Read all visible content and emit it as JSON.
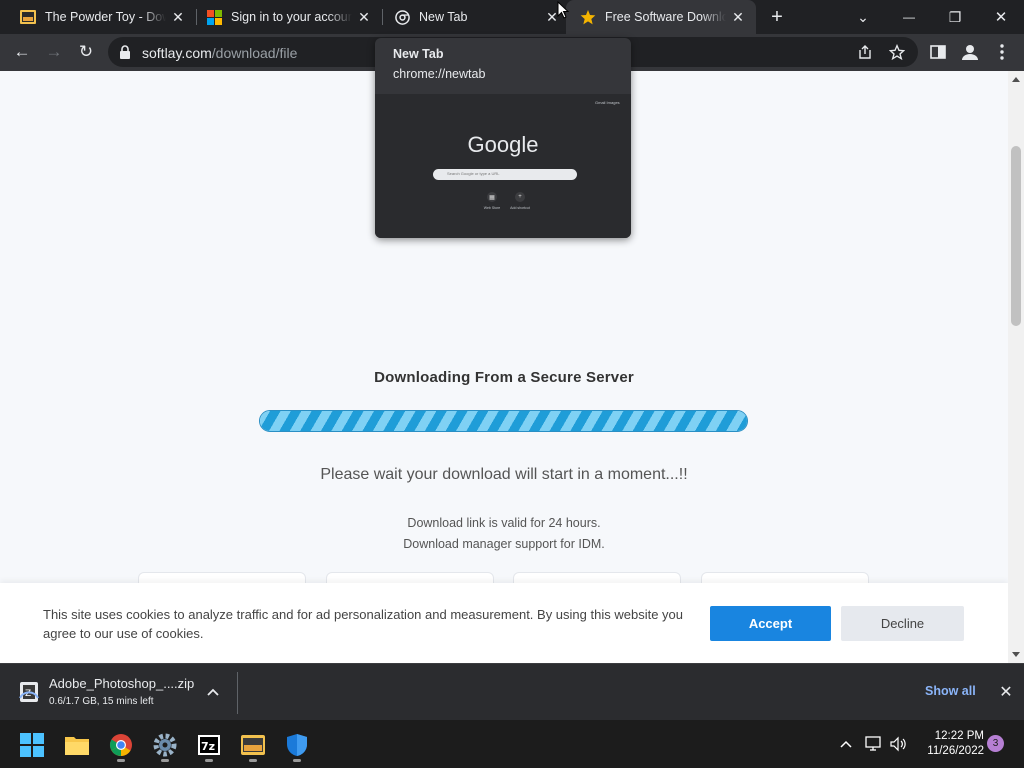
{
  "tabs": [
    {
      "title": "The Powder Toy - Download",
      "icon": "powder-toy-icon",
      "active": false
    },
    {
      "title": "Sign in to your account",
      "icon": "microsoft-icon",
      "active": false
    },
    {
      "title": "New Tab",
      "icon": "chrome-icon",
      "active": false
    },
    {
      "title": "Free Software Downloads",
      "icon": "star-icon",
      "active": true
    }
  ],
  "new_tab_symbol": "+",
  "window_controls": {
    "dropdown": "⌄",
    "minimize": "—",
    "restore": "❐",
    "close": "✕"
  },
  "toolbar": {
    "back": "←",
    "forward": "→",
    "reload": "↻"
  },
  "url": {
    "host": "softlay.com",
    "path": "/download/file"
  },
  "hover_card": {
    "title": "New Tab",
    "url": "chrome://newtab",
    "preview": {
      "logo": "Google",
      "search_placeholder": "Search Google or type a URL",
      "top_links": "Gmail  Images",
      "shortcuts": [
        "Web Store",
        "Add shortcut"
      ]
    }
  },
  "page": {
    "heading": "Downloading From a Secure Server",
    "progress": 1.0,
    "wait_text": "Please wait your download will start in a moment...!!",
    "info_line1": "Download link is valid for 24 hours.",
    "info_line2": "Download manager support for IDM."
  },
  "cookie_banner": {
    "text": "This site uses cookies to analyze traffic and for ad personalization and measurement. By using this website you agree to our use of cookies.",
    "accept": "Accept",
    "decline": "Decline"
  },
  "download_shelf": {
    "filename": "Adobe_Photoshop_....zip",
    "status": "0.6/1.7 GB, 15 mins left",
    "show_all": "Show all",
    "close": "✕"
  },
  "taskbar": {
    "apps": [
      "windows-start-icon",
      "file-explorer-icon",
      "chrome-icon",
      "settings-icon",
      "7zip-icon",
      "photos-icon",
      "security-icon"
    ],
    "clock_time": "12:22 PM",
    "clock_date": "11/26/2022",
    "notifications": "3"
  },
  "colors": {
    "accent_blue": "#1985e0",
    "progress_blue": "#33b1e6",
    "link_blue": "#8ab4f8"
  }
}
